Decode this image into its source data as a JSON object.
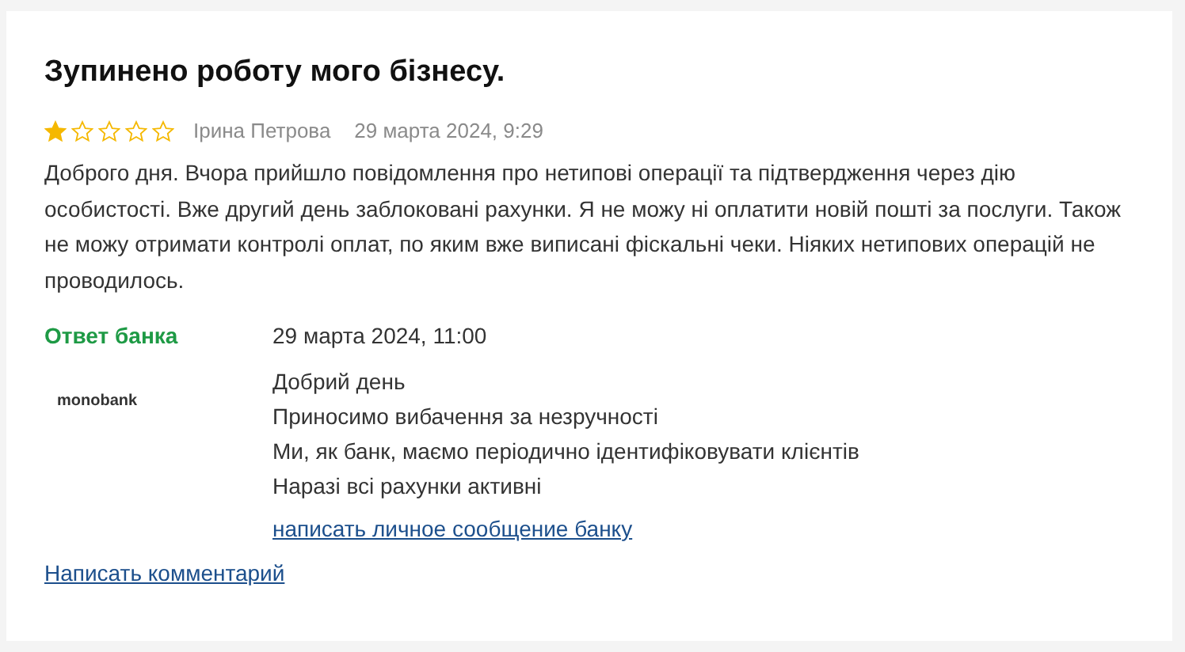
{
  "review": {
    "title": "Зупинено роботу мого бізнесу.",
    "stars": 1,
    "author": "Ірина Петрова",
    "date": "29 марта 2024, 9:29",
    "text": "Доброго дня. Вчора прийшло повідомлення про нетипові операції та підтвердження через дію особистості. Вже другий день заблоковані рахунки. Я не можу ні оплатити новій пошті за послуги. Також не можу отримати контролі оплат, по яким вже виписані фіскальні чеки. Ніяких нетипових операцій не проводилось."
  },
  "answer": {
    "label": "Ответ банка",
    "date": "29 марта 2024, 11:00",
    "logo": "monobank",
    "lines": [
      "Добрий день",
      "Приносимо вибачення за незручності",
      "Ми, як банк, маємо періодично ідентифіковувати клієнтів",
      "Наразі всі рахунки активні"
    ],
    "message_link": "написать личное сообщение банку"
  },
  "comment_link": "Написать комментарий"
}
